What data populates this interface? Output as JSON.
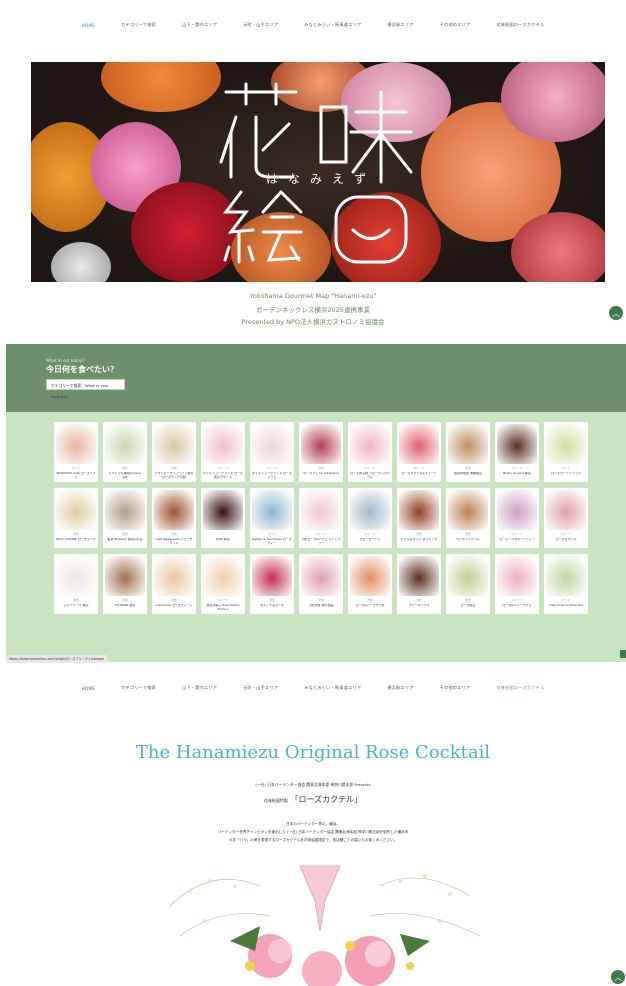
{
  "nav": {
    "items": [
      "HOME",
      "カテゴリーで検索",
      "山下・関内エリア",
      "元町・山手エリア",
      "みなとみらい・馬車道エリア",
      "横浜駅エリア",
      "その他のエリア",
      "花味絵図ローズカクテル"
    ],
    "active_top": 0,
    "active_bottom": 7
  },
  "hero": {
    "logo_line1": "花 味",
    "logo_reading": "はなみえず",
    "logo_line2": "絵",
    "logo_ring": "◡"
  },
  "tagline": {
    "line1": "Yokohama Gourmet Map \"Hanami-ezu\"",
    "line2": "ガーデンネックレス横浜2025連携事業",
    "line3": "Presented by NPO法人横浜ガストロノミ協議会"
  },
  "search": {
    "kicker": "What to eat today?",
    "title": "今日何を食べたい？",
    "select_value": "カテゴリーで検索　What is your favorite?"
  },
  "cards": [
    {
      "cat": "カフェ",
      "name": "WINDOWS Cafe ローズパフェ"
    },
    {
      "cat": "和食",
      "name": "ミストラル季節のmenu　set"
    },
    {
      "cat": "洋食",
      "name": "モザンビークヘアーイン春のローズランチ月替"
    },
    {
      "cat": "スイーツ",
      "name": "ホテルニューグランド ローズ色のデザート"
    },
    {
      "cat": "スイーツ",
      "name": "ホテルニューグランド ローズパフェ"
    },
    {
      "cat": "洋食",
      "name": "ザ・カフェ by Yokohama"
    },
    {
      "cat": "スイーツ",
      "name": "ローズ香る春 ～ローズ～カクテル"
    },
    {
      "cat": "スイーツ",
      "name": "ローズカクテル&スイーツ"
    },
    {
      "cat": "和食",
      "name": "横浜中華街 重慶飯店"
    },
    {
      "cat": "スイーツ",
      "name": "Bistro du port 横浜"
    },
    {
      "cat": "カフェ",
      "name": "ローズガーデンテラス"
    },
    {
      "cat": "洋食",
      "name": "RICO CUISINE ローズランチ"
    },
    {
      "cat": "和食",
      "name": "和食 Blossom 横浜元町店"
    },
    {
      "cat": "洋食",
      "name": "Café Restaurant ニューグランド"
    },
    {
      "cat": "バー",
      "name": "BAR 横浜"
    },
    {
      "cat": "カフェ",
      "name": "Kaikan & Tea House ローズティー"
    },
    {
      "cat": "スイーツ",
      "name": "元町ローズ&パフェ パティスリー"
    },
    {
      "cat": "スイーツ",
      "name": "ロゼ・ガーデン"
    },
    {
      "cat": "洋食",
      "name": "グリル＆ワイン ダイニング"
    },
    {
      "cat": "洋食",
      "name": "ベイサイドグリル"
    },
    {
      "cat": "スイーツ",
      "name": "ローズアフタヌーンティー"
    },
    {
      "cat": "スイーツ",
      "name": "ローズカクテル"
    },
    {
      "cat": "和食",
      "name": "ジャパニーズ 横浜"
    },
    {
      "cat": "洋食",
      "name": "TSUNAMI 横浜"
    },
    {
      "cat": "洋食",
      "name": "yokohama ローズプレート"
    },
    {
      "cat": "スイーツ",
      "name": "横浜洋菓子 Rose Pastry Factory"
    },
    {
      "cat": "洋食",
      "name": "ボルシチ＆ローズ"
    },
    {
      "cat": "洋食",
      "name": "元町中華 春の逸品"
    },
    {
      "cat": "洋食",
      "name": "ローズ&ハーブサラダ"
    },
    {
      "cat": "洋食",
      "name": "ステーキハウス"
    },
    {
      "cat": "和食",
      "name": "ローズ懐石"
    },
    {
      "cat": "スイーツ",
      "name": "ローズ&ベリーパフェ"
    },
    {
      "cat": "カフェ",
      "name": "Café Original Rose Tea"
    }
  ],
  "statusbar": "https://www.hanamiezu.com/single/ローズブルーティ/sample",
  "cocktail": {
    "title": "The Hanamiezu Original Rose Cocktail",
    "presents": "(一社) 日本バーテンダー協会 関東北海本部 神奈川県支部 Presents",
    "headline_prefix": "花味絵図特製",
    "headline": "「ローズカクテル」",
    "body1": "日本のバーテンダー界の、横浜。",
    "body2": "バーテンダー世界チャンピオンを輩出した (一社) 日本バーテンダー協会 関東北海本部 神奈川県支部が制作した横浜市",
    "body3": "の花「バラ」の美を表現するローズカクテルを花味絵図限定で。各店舗ごとの違いもお楽しみください。"
  },
  "colors": {
    "accent_green": "#3f7a4c",
    "section_green": "#6c8f6c",
    "grid_bg": "#c9e4c0",
    "cocktail_teal": "#4fb3c6"
  }
}
